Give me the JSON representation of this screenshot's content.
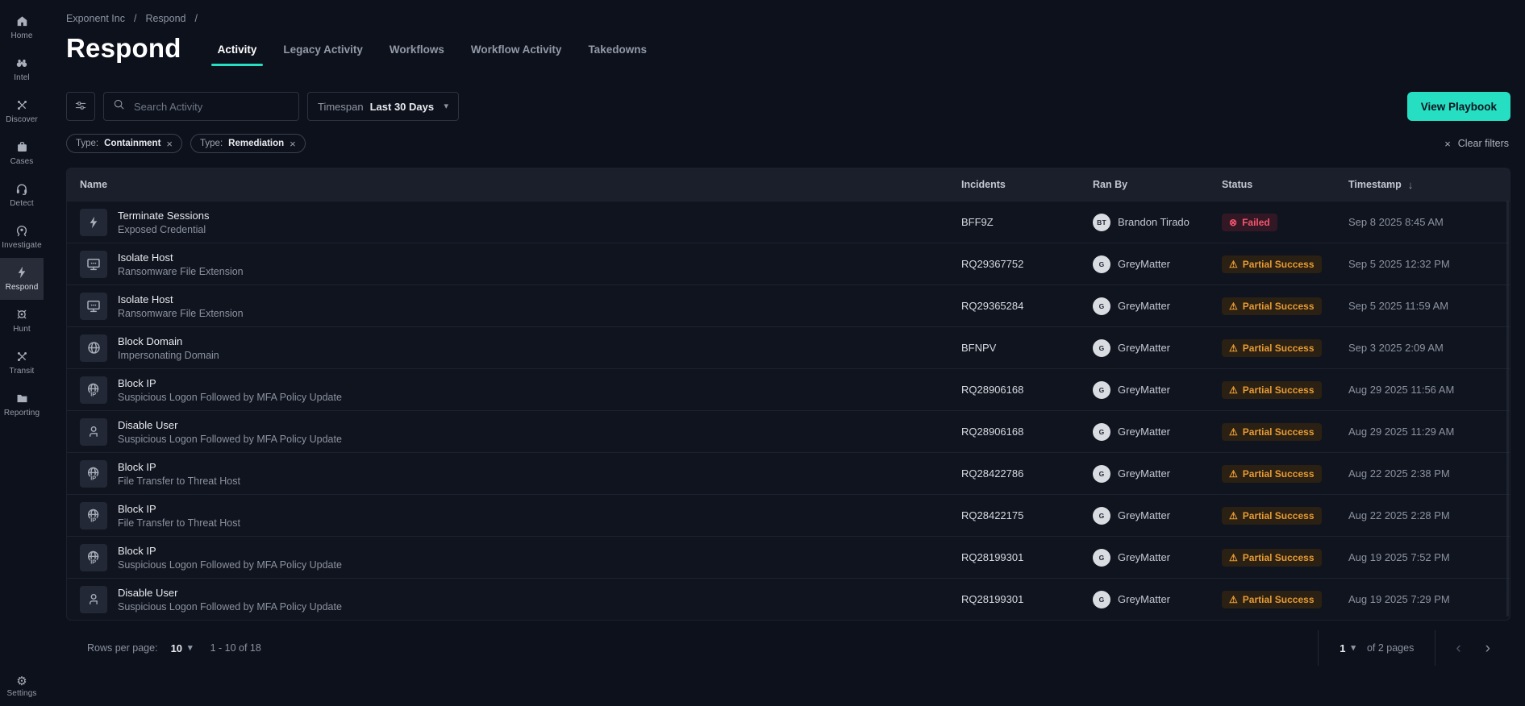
{
  "colors": {
    "accent": "#26dfc2",
    "failed": "#f4566f",
    "partial_success": "#e79b33"
  },
  "sidebar": {
    "items": [
      {
        "label": "Home",
        "icon": "home-icon",
        "active": false
      },
      {
        "label": "Intel",
        "icon": "binoculars-icon",
        "active": false
      },
      {
        "label": "Discover",
        "icon": "crossed-tools-icon",
        "active": false
      },
      {
        "label": "Cases",
        "icon": "briefcase-icon",
        "active": false
      },
      {
        "label": "Detect",
        "icon": "headset-icon",
        "active": false
      },
      {
        "label": "Investigate",
        "icon": "scanner-icon",
        "active": false
      },
      {
        "label": "Respond",
        "icon": "lightning-icon",
        "active": true
      },
      {
        "label": "Hunt",
        "icon": "crosshair-icon",
        "active": false
      },
      {
        "label": "Transit",
        "icon": "crossed-tools-icon",
        "active": false
      },
      {
        "label": "Reporting",
        "icon": "folder-icon",
        "active": false
      }
    ],
    "settings_label": "Settings"
  },
  "breadcrumb": {
    "items": [
      "Exponent Inc",
      "Respond"
    ],
    "separator": "/"
  },
  "header": {
    "title": "Respond",
    "tabs": [
      {
        "label": "Activity",
        "active": true
      },
      {
        "label": "Legacy Activity",
        "active": false
      },
      {
        "label": "Workflows",
        "active": false
      },
      {
        "label": "Workflow Activity",
        "active": false
      },
      {
        "label": "Takedowns",
        "active": false
      }
    ]
  },
  "toolbar": {
    "search_placeholder": "Search Activity",
    "timespan_label": "Timespan",
    "timespan_value": "Last 30 Days",
    "view_playbook_label": "View Playbook"
  },
  "filters": {
    "chips": [
      {
        "prefix": "Type:",
        "value": "Containment"
      },
      {
        "prefix": "Type:",
        "value": "Remediation"
      }
    ],
    "clear_label": "Clear filters"
  },
  "table": {
    "columns": [
      "Name",
      "Incidents",
      "Ran By",
      "Status",
      "Timestamp"
    ],
    "sort": {
      "column": "Timestamp",
      "direction": "desc"
    },
    "rows": [
      {
        "icon": "lightning-icon",
        "name": "Terminate Sessions",
        "description": "Exposed Credential",
        "incident": "BFF9Z",
        "ran_by": "Brandon Tirado",
        "ran_by_initials": "BT",
        "status": "Failed",
        "status_type": "failed",
        "timestamp": "Sep 8 2025 8:45 AM"
      },
      {
        "icon": "monitor-icon",
        "name": "Isolate Host",
        "description": "Ransomware File Extension",
        "incident": "RQ29367752",
        "ran_by": "GreyMatter",
        "ran_by_initials": "G",
        "status": "Partial Success",
        "status_type": "partial",
        "timestamp": "Sep 5 2025 12:32 PM"
      },
      {
        "icon": "monitor-icon",
        "name": "Isolate Host",
        "description": "Ransomware File Extension",
        "incident": "RQ29365284",
        "ran_by": "GreyMatter",
        "ran_by_initials": "G",
        "status": "Partial Success",
        "status_type": "partial",
        "timestamp": "Sep 5 2025 11:59 AM"
      },
      {
        "icon": "globe-icon",
        "name": "Block Domain",
        "description": "Impersonating Domain",
        "incident": "BFNPV",
        "ran_by": "GreyMatter",
        "ran_by_initials": "G",
        "status": "Partial Success",
        "status_type": "partial",
        "timestamp": "Sep 3 2025 2:09 AM"
      },
      {
        "icon": "globe-ip-icon",
        "name": "Block IP",
        "description": "Suspicious Logon Followed by MFA Policy Update",
        "incident": "RQ28906168",
        "ran_by": "GreyMatter",
        "ran_by_initials": "G",
        "status": "Partial Success",
        "status_type": "partial",
        "timestamp": "Aug 29 2025 11:56 AM"
      },
      {
        "icon": "user-icon",
        "name": "Disable User",
        "description": "Suspicious Logon Followed by MFA Policy Update",
        "incident": "RQ28906168",
        "ran_by": "GreyMatter",
        "ran_by_initials": "G",
        "status": "Partial Success",
        "status_type": "partial",
        "timestamp": "Aug 29 2025 11:29 AM"
      },
      {
        "icon": "globe-ip-icon",
        "name": "Block IP",
        "description": "File Transfer to Threat Host",
        "incident": "RQ28422786",
        "ran_by": "GreyMatter",
        "ran_by_initials": "G",
        "status": "Partial Success",
        "status_type": "partial",
        "timestamp": "Aug 22 2025 2:38 PM"
      },
      {
        "icon": "globe-ip-icon",
        "name": "Block IP",
        "description": "File Transfer to Threat Host",
        "incident": "RQ28422175",
        "ran_by": "GreyMatter",
        "ran_by_initials": "G",
        "status": "Partial Success",
        "status_type": "partial",
        "timestamp": "Aug 22 2025 2:28 PM"
      },
      {
        "icon": "globe-ip-icon",
        "name": "Block IP",
        "description": "Suspicious Logon Followed by MFA Policy Update",
        "incident": "RQ28199301",
        "ran_by": "GreyMatter",
        "ran_by_initials": "G",
        "status": "Partial Success",
        "status_type": "partial",
        "timestamp": "Aug 19 2025 7:52 PM"
      },
      {
        "icon": "user-icon",
        "name": "Disable User",
        "description": "Suspicious Logon Followed by MFA Policy Update",
        "incident": "RQ28199301",
        "ran_by": "GreyMatter",
        "ran_by_initials": "G",
        "status": "Partial Success",
        "status_type": "partial",
        "timestamp": "Aug 19 2025 7:29 PM"
      }
    ]
  },
  "pagination": {
    "rows_per_page_label": "Rows per page:",
    "rows_per_page_value": "10",
    "range_text": "1 - 10 of 18",
    "page_value": "1",
    "pages_text": "of 2 pages"
  }
}
